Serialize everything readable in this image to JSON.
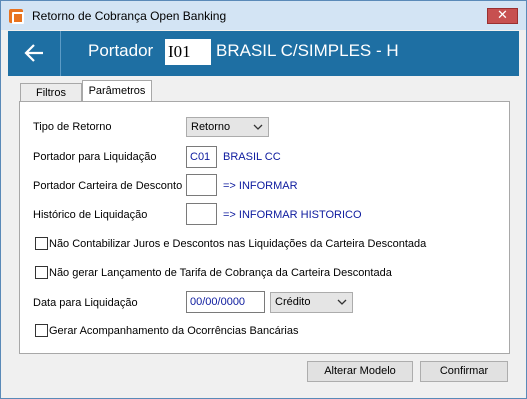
{
  "window": {
    "title": "Retorno de Cobrança Open Banking",
    "close_glyph": "✕"
  },
  "header": {
    "label": "Portador",
    "code": "I01",
    "name": "BRASIL C/SIMPLES - H"
  },
  "tabs": [
    {
      "label": "Filtros"
    },
    {
      "label": "Parâmetros"
    }
  ],
  "form": {
    "tipo_retorno": {
      "label": "Tipo de Retorno",
      "value": "Retorno"
    },
    "portador_liquidacao": {
      "label": "Portador para Liquidação",
      "code": "C01",
      "desc": "BRASIL CC"
    },
    "portador_carteira": {
      "label": "Portador Carteira de Desconto",
      "code": "",
      "desc": "=> INFORMAR"
    },
    "historico": {
      "label": "Histórico de Liquidação",
      "code": "",
      "desc": "=> INFORMAR HISTORICO"
    },
    "chk_juros": {
      "label": "Não Contabilizar Juros e Descontos nas Liquidações da Carteira Descontada",
      "checked": false
    },
    "chk_tarifa": {
      "label": "Não gerar Lançamento de Tarifa de Cobrança da Carteira Descontada",
      "checked": false
    },
    "data_liquidacao": {
      "label": "Data para Liquidação",
      "value": "00/00/0000",
      "mode": "Crédito"
    },
    "chk_acompanhamento": {
      "label": "Gerar Acompanhamento da Ocorrências Bancárias",
      "checked": false
    }
  },
  "buttons": {
    "alterar_modelo": "Alterar Modelo",
    "confirmar": "Confirmar"
  },
  "colors": {
    "header_bg": "#1e6fa3",
    "titlebar_bg": "#d3e4f4",
    "link_blue": "#0c1a9e",
    "close_red": "#c75050"
  }
}
